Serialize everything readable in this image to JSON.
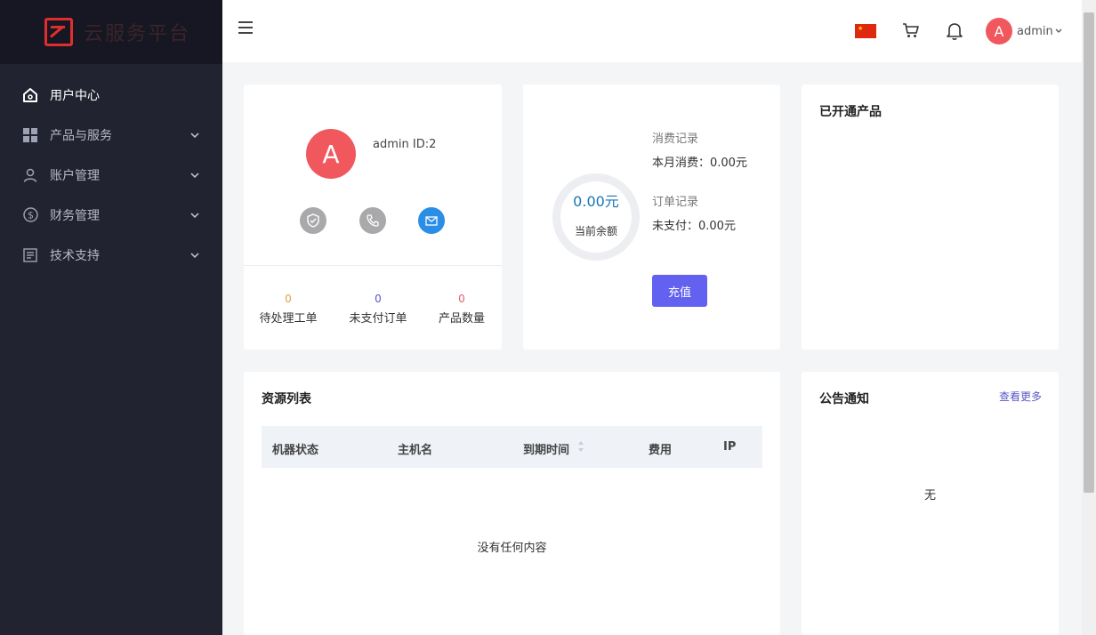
{
  "brand": {
    "name": "云服务平台"
  },
  "sidebar": {
    "items": [
      {
        "label": "用户中心",
        "icon": "home-icon",
        "active": true
      },
      {
        "label": "产品与服务",
        "icon": "grid-icon"
      },
      {
        "label": "账户管理",
        "icon": "user-icon"
      },
      {
        "label": "财务管理",
        "icon": "dollar-icon"
      },
      {
        "label": "技术支持",
        "icon": "document-icon"
      }
    ]
  },
  "header": {
    "language_flag": "cn-flag-icon",
    "avatar_letter": "A",
    "username": "admin"
  },
  "profile": {
    "avatar_letter": "A",
    "id_text": "admin ID:2",
    "stats": [
      {
        "value": "0",
        "label": "待处理工单",
        "color": "#d6a64a"
      },
      {
        "value": "0",
        "label": "未支付订单",
        "color": "#5a57c8"
      },
      {
        "value": "0",
        "label": "产品数量",
        "color": "#e0606a"
      }
    ]
  },
  "balance": {
    "value": "0.00元",
    "label": "当前余额",
    "consume_title": "消费记录",
    "consume_value": "本月消费：0.00元",
    "order_title": "订单记录",
    "order_value": "未支付：0.00元",
    "recharge_label": "充值"
  },
  "products": {
    "title": "已开通产品"
  },
  "resources": {
    "title": "资源列表",
    "columns": [
      "机器状态",
      "主机名",
      "到期时间",
      "费用",
      "IP"
    ],
    "empty_text": "没有任何内容"
  },
  "notice": {
    "title": "公告通知",
    "more_label": "查看更多",
    "empty_text": "无"
  },
  "colors": {
    "sidebar_bg": "#222331",
    "accent": "#6261f0",
    "avatar": "#f0585d",
    "balance_blue": "#1976b5"
  }
}
